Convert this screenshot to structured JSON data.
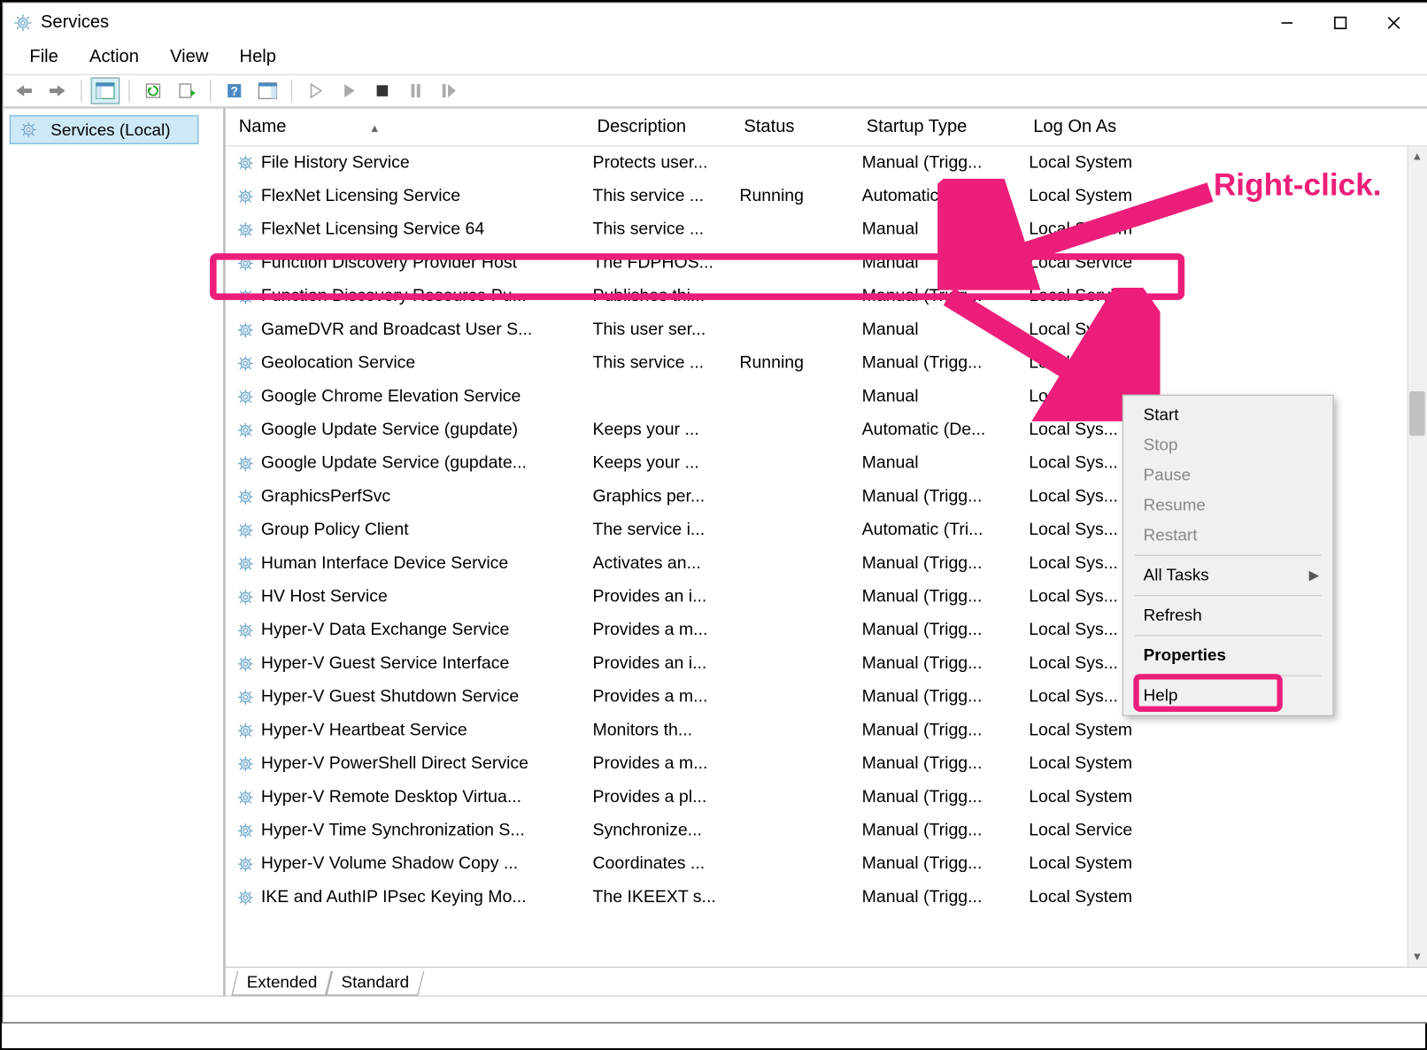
{
  "window": {
    "title": "Services"
  },
  "menu": {
    "file": "File",
    "action": "Action",
    "view": "View",
    "help": "Help"
  },
  "sidebar": {
    "root": "Services (Local)"
  },
  "columns": {
    "name": "Name",
    "description": "Description",
    "status": "Status",
    "startup": "Startup Type",
    "logon": "Log On As"
  },
  "sort_col": "Name",
  "rows": [
    {
      "name": "File History Service",
      "desc": "Protects user...",
      "status": "",
      "startup": "Manual (Trigg...",
      "logon": "Local System"
    },
    {
      "name": "FlexNet Licensing Service",
      "desc": "This service ...",
      "status": "Running",
      "startup": "Automatic",
      "logon": "Local System"
    },
    {
      "name": "FlexNet Licensing Service 64",
      "desc": "This service ...",
      "status": "",
      "startup": "Manual",
      "logon": "Local System"
    },
    {
      "name": "Function Discovery Provider Host",
      "desc": "The FDPHOS...",
      "status": "",
      "startup": "Manual",
      "logon": "Local Service"
    },
    {
      "name": "Function Discovery Resource Pu...",
      "desc": "Publishes thi...",
      "status": "",
      "startup": "Manual (Trigg...",
      "logon": "Local Service"
    },
    {
      "name": "GameDVR and Broadcast User S...",
      "desc": "This user ser...",
      "status": "",
      "startup": "Manual",
      "logon": "Local System"
    },
    {
      "name": "Geolocation Service",
      "desc": "This service ...",
      "status": "Running",
      "startup": "Manual (Trigg...",
      "logon": "Local Sys..."
    },
    {
      "name": "Google Chrome Elevation Service",
      "desc": "",
      "status": "",
      "startup": "Manual",
      "logon": "Local Sys..."
    },
    {
      "name": "Google Update Service (gupdate)",
      "desc": "Keeps your ...",
      "status": "",
      "startup": "Automatic (De...",
      "logon": "Local Sys..."
    },
    {
      "name": "Google Update Service (gupdate...",
      "desc": "Keeps your ...",
      "status": "",
      "startup": "Manual",
      "logon": "Local Sys..."
    },
    {
      "name": "GraphicsPerfSvc",
      "desc": "Graphics per...",
      "status": "",
      "startup": "Manual (Trigg...",
      "logon": "Local Sys..."
    },
    {
      "name": "Group Policy Client",
      "desc": "The service i...",
      "status": "",
      "startup": "Automatic (Tri...",
      "logon": "Local Sys..."
    },
    {
      "name": "Human Interface Device Service",
      "desc": "Activates an...",
      "status": "",
      "startup": "Manual (Trigg...",
      "logon": "Local Sys..."
    },
    {
      "name": "HV Host Service",
      "desc": "Provides an i...",
      "status": "",
      "startup": "Manual (Trigg...",
      "logon": "Local Sys..."
    },
    {
      "name": "Hyper-V Data Exchange Service",
      "desc": "Provides a m...",
      "status": "",
      "startup": "Manual (Trigg...",
      "logon": "Local Sys..."
    },
    {
      "name": "Hyper-V Guest Service Interface",
      "desc": "Provides an i...",
      "status": "",
      "startup": "Manual (Trigg...",
      "logon": "Local Sys..."
    },
    {
      "name": "Hyper-V Guest Shutdown Service",
      "desc": "Provides a m...",
      "status": "",
      "startup": "Manual (Trigg...",
      "logon": "Local Sys..."
    },
    {
      "name": "Hyper-V Heartbeat Service",
      "desc": "Monitors th...",
      "status": "",
      "startup": "Manual (Trigg...",
      "logon": "Local System"
    },
    {
      "name": "Hyper-V PowerShell Direct Service",
      "desc": "Provides a m...",
      "status": "",
      "startup": "Manual (Trigg...",
      "logon": "Local System"
    },
    {
      "name": "Hyper-V Remote Desktop Virtua...",
      "desc": "Provides a pl...",
      "status": "",
      "startup": "Manual (Trigg...",
      "logon": "Local System"
    },
    {
      "name": "Hyper-V Time Synchronization S...",
      "desc": "Synchronize...",
      "status": "",
      "startup": "Manual (Trigg...",
      "logon": "Local Service"
    },
    {
      "name": "Hyper-V Volume Shadow Copy ...",
      "desc": "Coordinates ...",
      "status": "",
      "startup": "Manual (Trigg...",
      "logon": "Local System"
    },
    {
      "name": "IKE and AuthIP IPsec Keying Mo...",
      "desc": "The IKEEXT s...",
      "status": "",
      "startup": "Manual (Trigg...",
      "logon": "Local System"
    }
  ],
  "tabs": {
    "extended": "Extended",
    "standard": "Standard"
  },
  "context_menu": {
    "start": "Start",
    "stop": "Stop",
    "pause": "Pause",
    "resume": "Resume",
    "restart": "Restart",
    "all_tasks": "All Tasks",
    "refresh": "Refresh",
    "properties": "Properties",
    "help": "Help"
  },
  "annotation": {
    "label": "Right-click."
  }
}
